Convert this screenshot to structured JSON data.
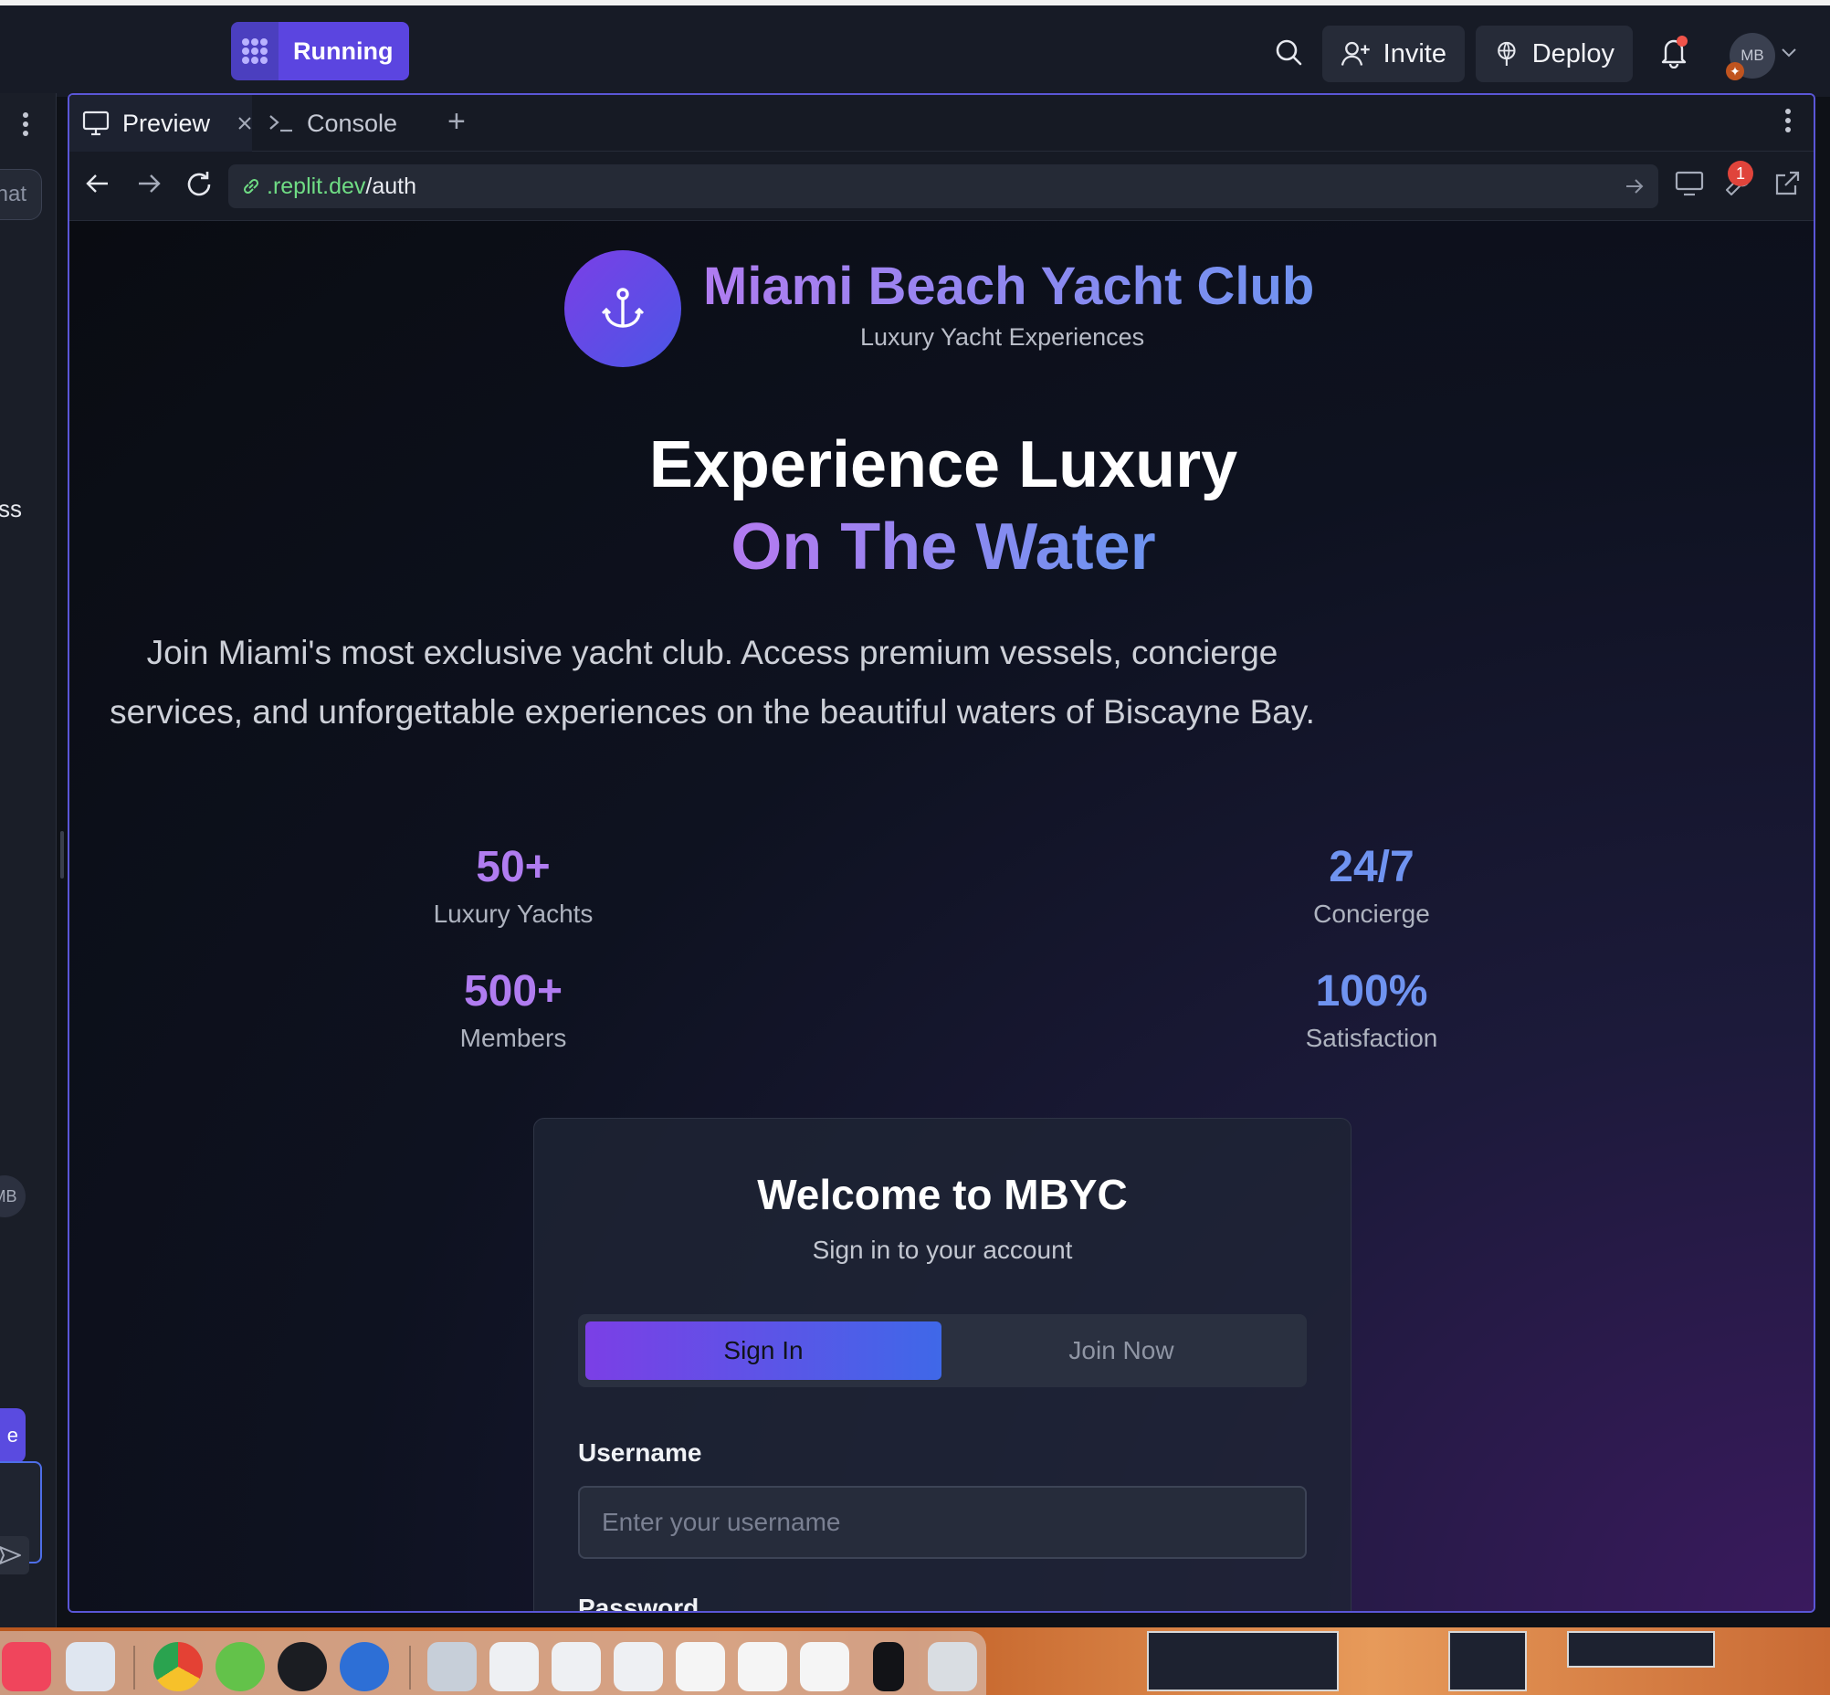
{
  "header": {
    "run_label": "Running",
    "invite_label": "Invite",
    "deploy_label": "Deploy",
    "avatar_initials": "MB"
  },
  "sidebar": {
    "chat_fragment": "hat",
    "text_fragment": "ss",
    "avatar_initials": "MB",
    "tab_fragment": "e"
  },
  "tabs": [
    {
      "label": "Preview",
      "icon": "monitor-icon"
    },
    {
      "label": "Console",
      "icon": "terminal-icon"
    }
  ],
  "url": {
    "domain": ".replit.dev",
    "path": "/auth"
  },
  "devtools_badge": "1",
  "site": {
    "brand_title": "Miami Beach Yacht Club",
    "brand_subtitle": "Luxury Yacht Experiences",
    "hero_line1": "Experience Luxury",
    "hero_line2": "On The Water",
    "hero_desc": "Join Miami's most exclusive yacht club. Access premium vessels, concierge services, and unforgettable experiences on the beautiful waters of Biscayne Bay.",
    "stats": [
      {
        "value": "50+",
        "label": "Luxury Yachts"
      },
      {
        "value": "24/7",
        "label": "Concierge"
      },
      {
        "value": "500+",
        "label": "Members"
      },
      {
        "value": "100%",
        "label": "Satisfaction"
      }
    ],
    "card": {
      "title": "Welcome to MBYC",
      "subtitle": "Sign in to your account",
      "signin_tab": "Sign In",
      "join_tab": "Join Now",
      "username_label": "Username",
      "username_placeholder": "Enter your username",
      "password_label": "Password"
    }
  },
  "colors": {
    "accent_purple": "#b07cf0",
    "accent_blue": "#6f93f0",
    "run_button": "#5b45e0",
    "pane_border": "#5a56d6"
  }
}
